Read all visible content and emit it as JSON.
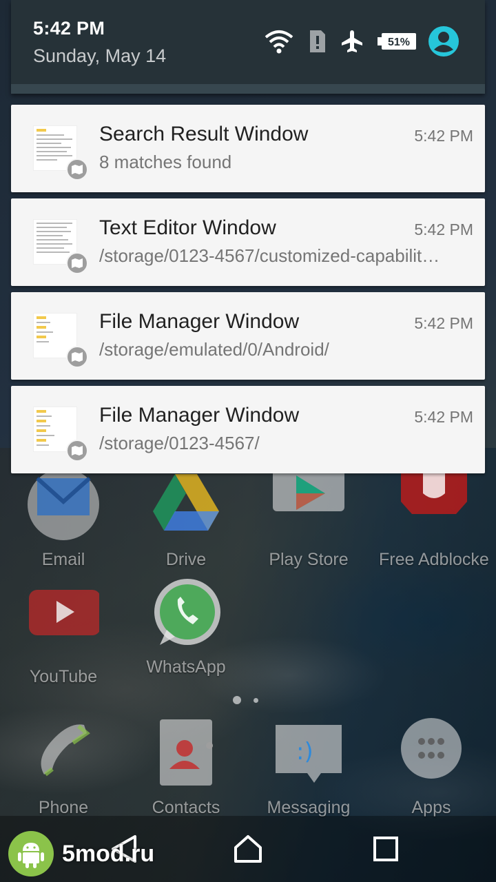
{
  "status_bar": {
    "time": "5:42 PM",
    "date": "Sunday, May 14",
    "battery_level": "51%",
    "icons": [
      "wifi-icon",
      "no-sim-icon",
      "airplane-mode-icon",
      "battery-icon",
      "account-icon"
    ],
    "account_color": "#26c6da"
  },
  "notifications": [
    {
      "title": "Search Result Window",
      "text": "8 matches found",
      "time": "5:42 PM"
    },
    {
      "title": "Text Editor Window",
      "text": "/storage/0123-4567/customized-capabilit…",
      "time": "5:42 PM"
    },
    {
      "title": "File Manager Window",
      "text": "/storage/emulated/0/Android/",
      "time": "5:42 PM"
    },
    {
      "title": "File Manager Window",
      "text": "/storage/0123-4567/",
      "time": "5:42 PM"
    }
  ],
  "home_apps": [
    {
      "label": "Email",
      "icon": "email-icon"
    },
    {
      "label": "Drive",
      "icon": "drive-icon"
    },
    {
      "label": "Play Store",
      "icon": "play-store-icon"
    },
    {
      "label": "Free Adblocker B",
      "icon": "adblocker-icon"
    },
    {
      "label": "YouTube",
      "icon": "youtube-icon"
    },
    {
      "label": "WhatsApp",
      "icon": "whatsapp-icon"
    }
  ],
  "dock_apps": [
    {
      "label": "Phone",
      "icon": "phone-icon"
    },
    {
      "label": "Contacts",
      "icon": "contacts-icon"
    },
    {
      "label": "Messaging",
      "icon": "messaging-icon"
    },
    {
      "label": "Apps",
      "icon": "apps-icon"
    }
  ],
  "navigation": {
    "buttons": [
      "back-icon",
      "home-icon",
      "recents-icon"
    ]
  },
  "watermark": {
    "text": "5mod.ru",
    "logo_color": "#8bc34a"
  }
}
